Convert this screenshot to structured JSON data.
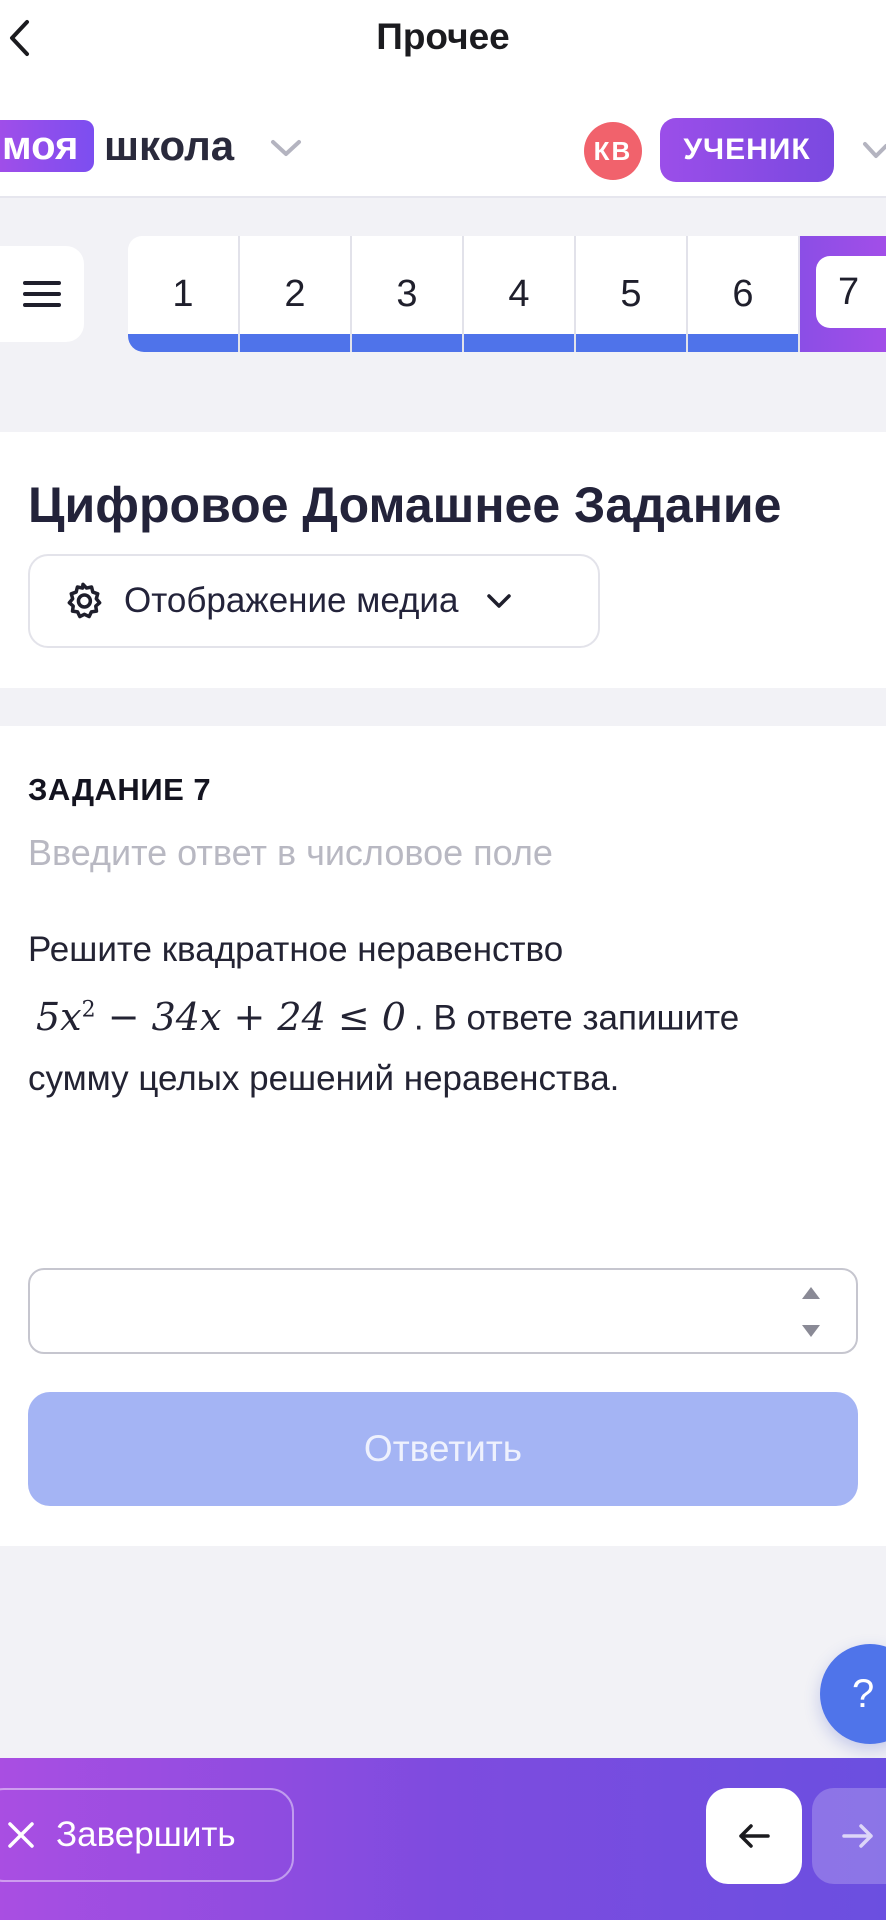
{
  "navbar": {
    "title": "Прочее"
  },
  "header": {
    "logo_part1": "моя",
    "logo_part2": "школа",
    "avatar_initials": "КВ",
    "role": "УЧЕНИК"
  },
  "tabs": {
    "items": [
      "1",
      "2",
      "3",
      "4",
      "5",
      "6"
    ],
    "active": "7"
  },
  "main": {
    "title": "Цифровое Домашнее Задание",
    "media_button": "Отображение медиа"
  },
  "task": {
    "number_label": "ЗАДАНИЕ 7",
    "hint": "Введите ответ в числовое поле",
    "text_before": "Решите квадратное неравенство",
    "formula_a": "5x",
    "formula_exp": "2",
    "formula_b": " − 34x + 24 ≤ 0",
    "text_after": ". В ответе запишите сумму целых решений неравенства.",
    "answer_value": "",
    "submit_label": "Ответить"
  },
  "help": {
    "label": "?"
  },
  "footer": {
    "finish_label": "Завершить"
  },
  "colors": {
    "accent_blue": "#4f73ea",
    "accent_purple": "#8b4ee6",
    "avatar_red": "#f1626c",
    "submit_disabled": "#a4b4f4"
  },
  "icons": {
    "back": "chevron-left-icon",
    "menu": "hamburger-icon",
    "settings": "gear-icon",
    "finish": "close-icon",
    "prev": "arrow-left-icon",
    "next": "arrow-right-icon"
  }
}
